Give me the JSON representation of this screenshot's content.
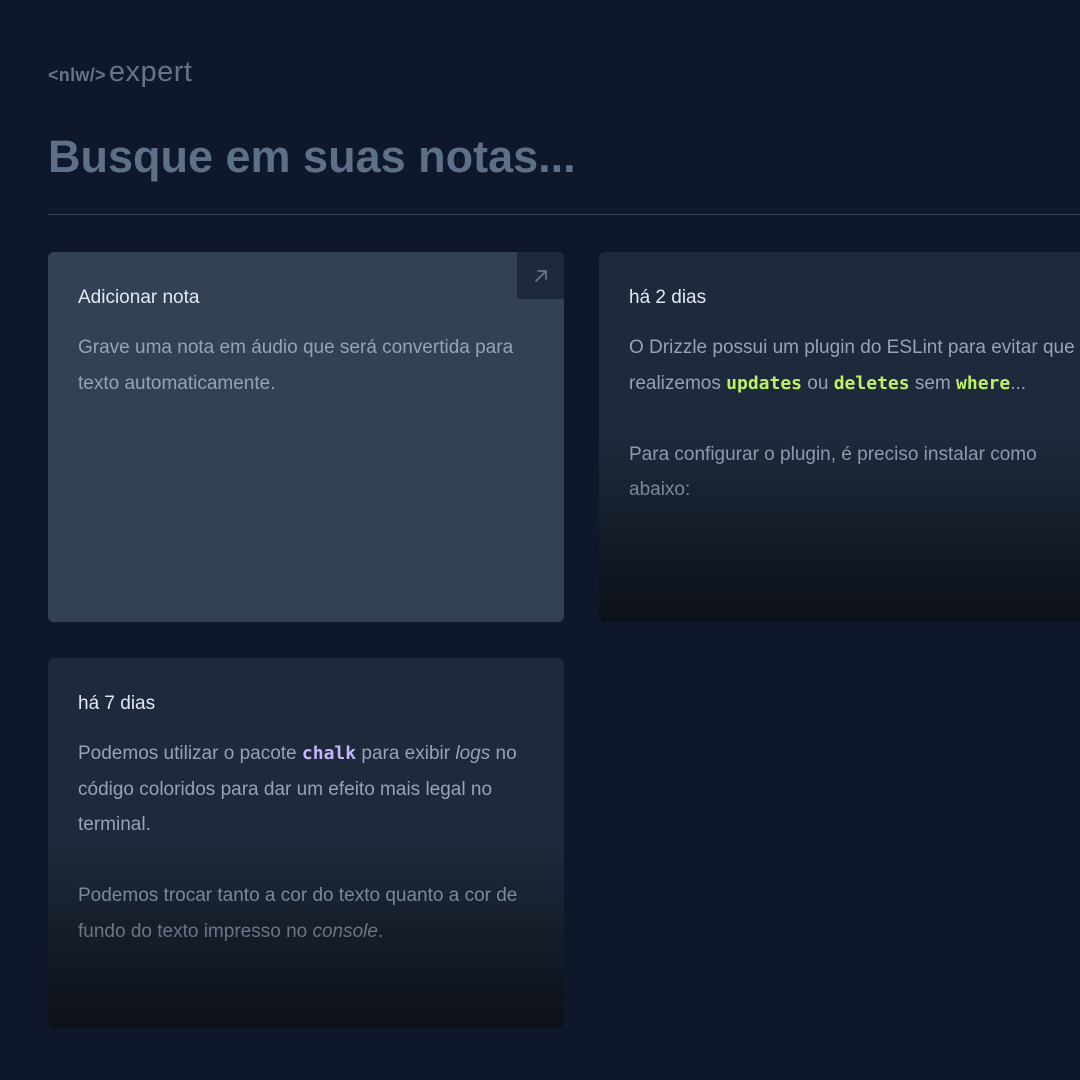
{
  "logo": {
    "tag": "<nlw/>",
    "word": "expert"
  },
  "search": {
    "placeholder": "Busque em suas notas..."
  },
  "add_card": {
    "title": "Adicionar nota",
    "description": "Grave uma nota em áudio que será convertida para texto automaticamente.",
    "icon": "arrow-up-right-icon"
  },
  "notes": [
    {
      "date": "há 2 dias",
      "p1": {
        "t1": "O Drizzle possui um plugin do ESLint para evitar que realizemos ",
        "c1": "updates",
        "t2": " ou ",
        "c2": "deletes",
        "t3": " sem ",
        "c3": "where",
        "t4": "..."
      },
      "p2": "Para configurar o plugin, é preciso instalar como abaixo:"
    },
    {
      "date": "há 7 dias",
      "p1": {
        "t1": "Podemos utilizar o pacote ",
        "c1": "chalk",
        "t2": " para exibir ",
        "e1": "logs",
        "t3": " no código coloridos para dar um efeito mais legal no terminal."
      },
      "p2": {
        "t1": "Podemos trocar tanto a cor do texto quanto a cor de fundo do texto impresso no ",
        "e1": "console",
        "t2": "."
      }
    }
  ],
  "colors": {
    "background": "#0f172a",
    "card": "#1e293b",
    "card_add": "#334155",
    "code_green": "#bef264",
    "code_purple": "#c4b5fd"
  }
}
